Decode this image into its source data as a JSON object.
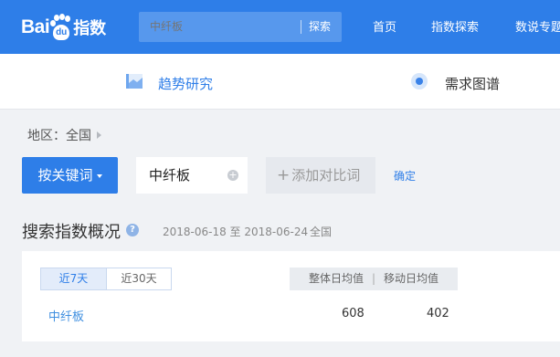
{
  "header": {
    "logo_text": "Bai",
    "logo_du": "du",
    "logo_product": "指数",
    "search": {
      "placeholder": "中纤板",
      "button_label": "探索"
    },
    "nav": [
      "首页",
      "指数探索",
      "数说专题"
    ]
  },
  "subnav": {
    "items": [
      "趋势研究",
      "需求图谱"
    ]
  },
  "breadcrumb": {
    "label": "地区：全国"
  },
  "keyword_bar": {
    "dropdown_label": "按关键词",
    "keyword": "中纤板",
    "add_label": "添加对比词",
    "confirm_label": "确定"
  },
  "overview": {
    "title": "搜索指数概况",
    "help": "?",
    "date_range": "2018-06-18 至 2018-06-24",
    "region": "全国",
    "tabs": [
      "近7天",
      "近30天"
    ],
    "metrics": [
      "整体日均值",
      "移动日均值"
    ],
    "metric_separator": "|",
    "rows": [
      {
        "keyword": "中纤板",
        "overall": "608",
        "mobile": "402"
      }
    ]
  },
  "colors": {
    "brand": "#2e7ee8",
    "link": "#3f8fe0"
  }
}
